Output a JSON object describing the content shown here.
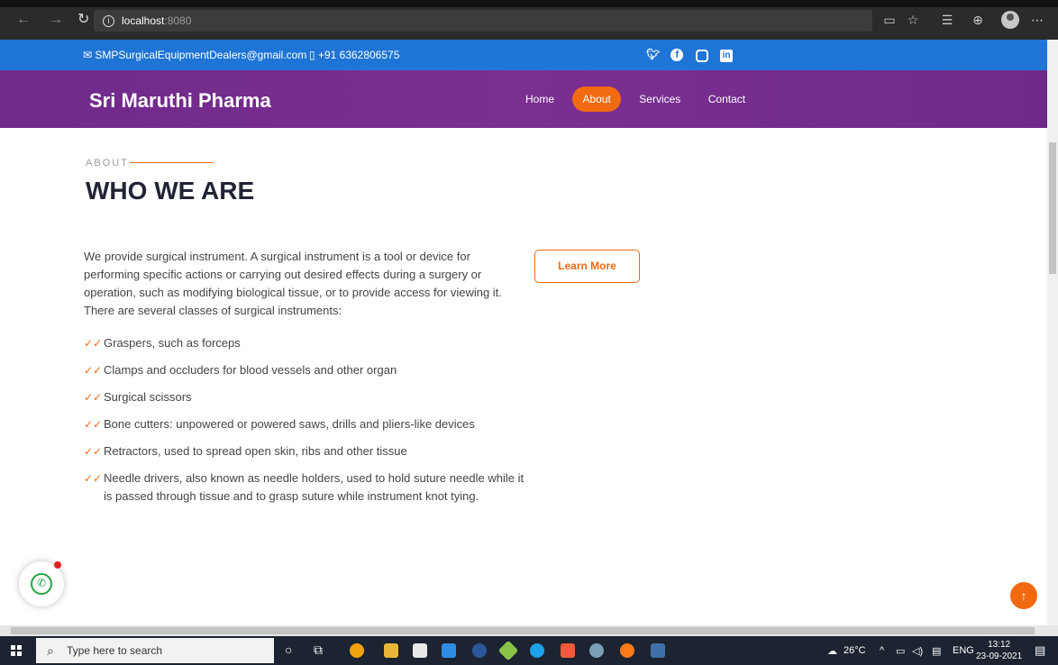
{
  "browser": {
    "host": "localhost",
    "port": ":8080"
  },
  "topbar": {
    "email": "SMPSurgicalEquipmentDealers@gmail.com",
    "phone": "+91 6362806575"
  },
  "header": {
    "brand": "Sri Maruthi Pharma",
    "menu": [
      "Home",
      "About",
      "Services",
      "Contact"
    ],
    "active": "About"
  },
  "about": {
    "label": "ABOUT",
    "title": "WHO WE ARE",
    "intro": "We provide surgical instrument. A surgical instrument is a tool or device for performing specific actions or carrying out desired effects during a surgery or operation, such as modifying biological tissue, or to provide access for viewing it. There are several classes of surgical instruments:",
    "items": [
      "Graspers, such as forceps",
      "Clamps and occluders for blood vessels and other organ",
      "Surgical scissors",
      "Bone cutters: unpowered or powered saws, drills and pliers-like devices",
      "Retractors, used to spread open skin, ribs and other tissue",
      "Needle drivers, also known as needle holders, used to hold suture needle while it is passed through tissue and to grasp suture while instrument knot tying."
    ],
    "learn_more": "Learn More"
  },
  "taskbar": {
    "search_placeholder": "Type here to search",
    "weather": "26°C",
    "lang": "ENG",
    "time": "13:12",
    "date": "23-09-2021"
  },
  "colors": {
    "topbar": "#1f75d6",
    "header": "#7b2f91",
    "accent": "#f06a12",
    "title": "#222436"
  }
}
